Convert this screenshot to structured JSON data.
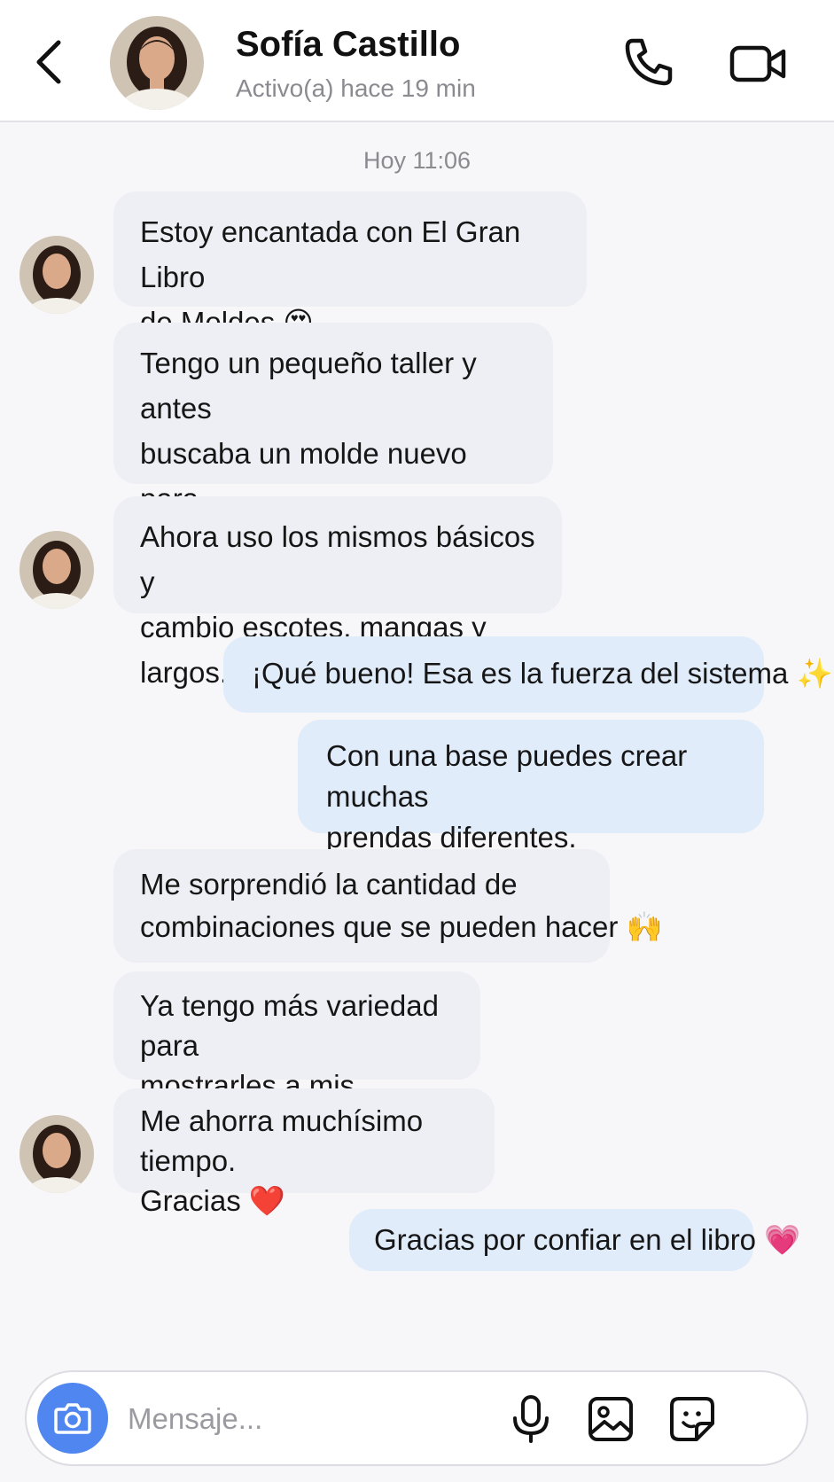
{
  "header": {
    "name": "Sofía Castillo",
    "status": "Activo(a) hace 19 min"
  },
  "date_separator": "Hoy 11:06",
  "messages": [
    {
      "direction": "in",
      "text": "Estoy encantada con El Gran Libro\nde Moldes 😍"
    },
    {
      "direction": "in",
      "text": "Tengo un pequeño taller y antes\nbuscaba un molde nuevo para\ncada pedido."
    },
    {
      "direction": "in",
      "text": "Ahora uso los mismos básicos y\ncambio escotes, mangas y largos."
    },
    {
      "direction": "out",
      "text": "¡Qué bueno! Esa es la fuerza del sistema ✨"
    },
    {
      "direction": "out",
      "text": "Con una base puedes crear muchas\nprendas diferentes."
    },
    {
      "direction": "in",
      "text": "Me sorprendió la cantidad de\ncombinaciones que se pueden hacer 🙌"
    },
    {
      "direction": "in",
      "text": "Ya tengo más variedad para\nmostrarles a mis clientas."
    },
    {
      "direction": "in",
      "text": "Me ahorra muchísimo tiempo.\nGracias ❤️"
    },
    {
      "direction": "out",
      "text": "Gracias por confiar en el libro 💗"
    }
  ],
  "composer": {
    "placeholder": "Mensaje..."
  },
  "icons": {
    "back": "chevron-left-icon",
    "call": "phone-icon",
    "video": "video-camera-icon",
    "camera": "camera-icon",
    "mic": "microphone-icon",
    "gallery": "image-icon",
    "sticker": "sticker-icon"
  },
  "colors": {
    "incoming_bubble": "#eeeff4",
    "outgoing_bubble": "#e1ecfb",
    "camera_button": "#4f86f0"
  }
}
